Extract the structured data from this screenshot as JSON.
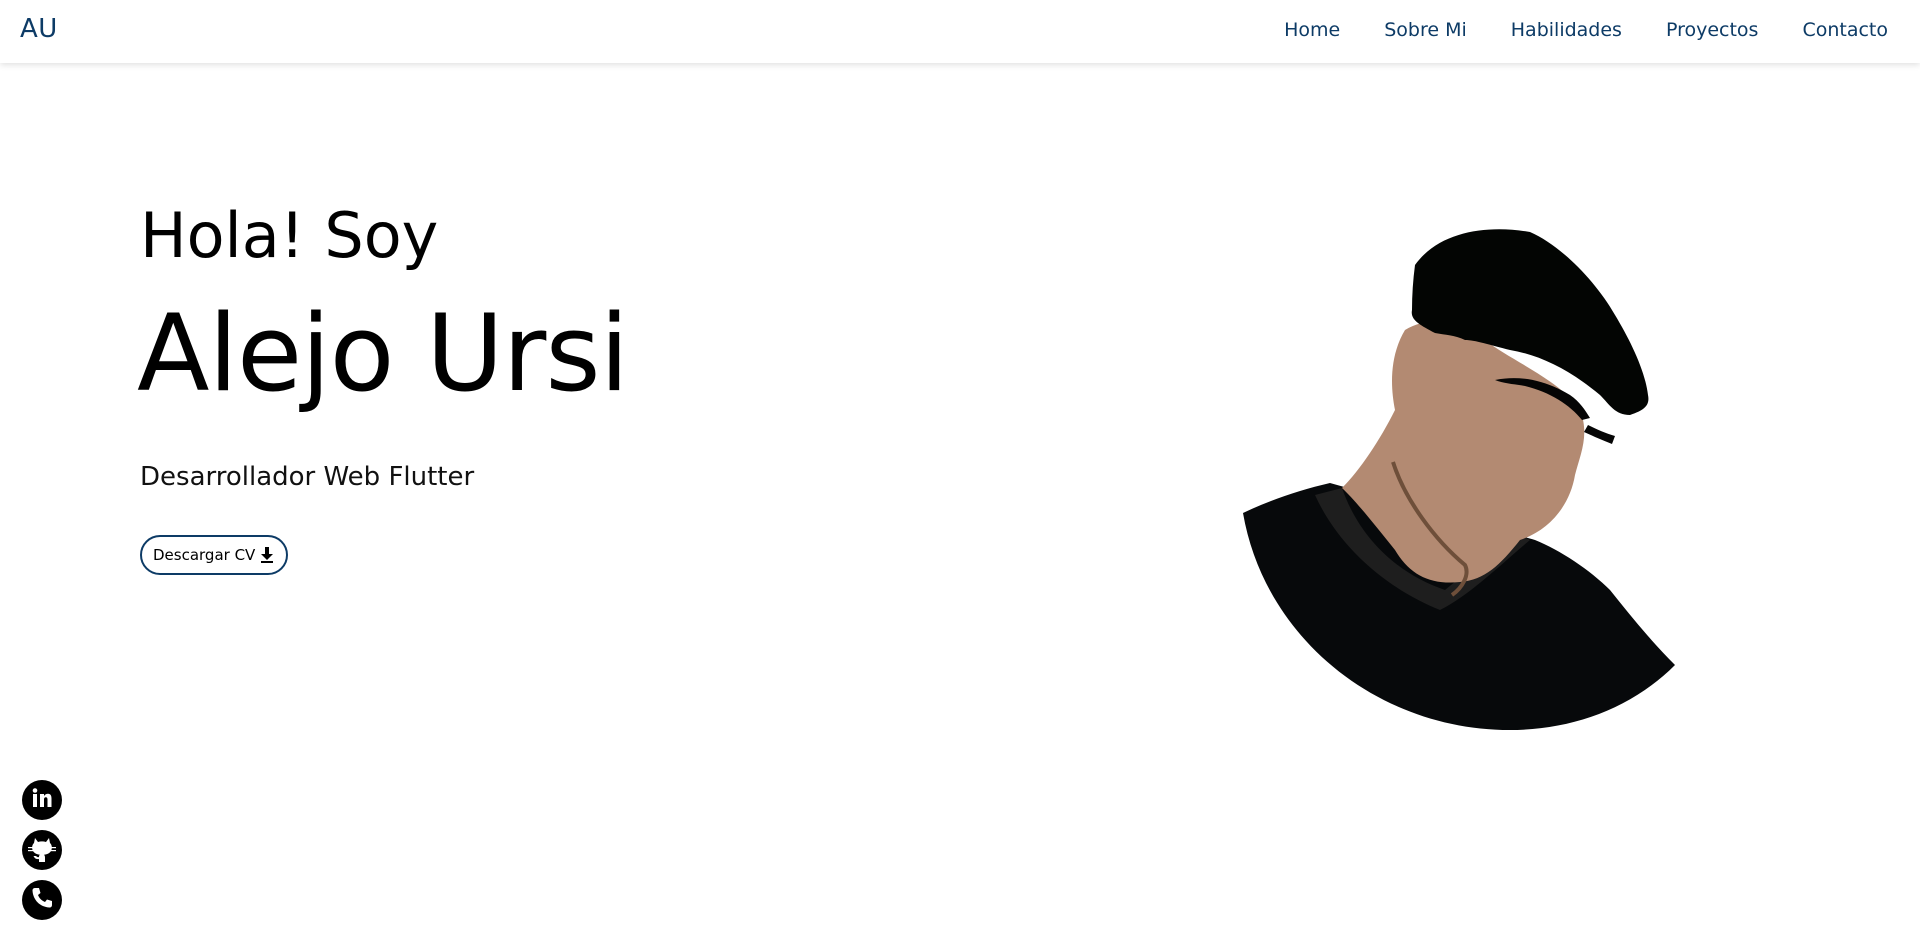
{
  "brand": {
    "logo": "AU",
    "color": "#0d3b66"
  },
  "nav": {
    "items": [
      {
        "label": "Home"
      },
      {
        "label": "Sobre Mi"
      },
      {
        "label": "Habilidades"
      },
      {
        "label": "Proyectos"
      },
      {
        "label": "Contacto"
      }
    ]
  },
  "hero": {
    "greeting": "Hola! Soy",
    "name": "Alejo Ursi",
    "role": "Desarrollador Web Flutter",
    "cv_button": {
      "label": "Descargar CV",
      "icon": "download-icon"
    },
    "avatar": {
      "icon": "avatar-illustration"
    }
  },
  "social": {
    "items": [
      {
        "icon": "linkedin-icon"
      },
      {
        "icon": "github-icon"
      },
      {
        "icon": "phone-icon"
      }
    ]
  }
}
